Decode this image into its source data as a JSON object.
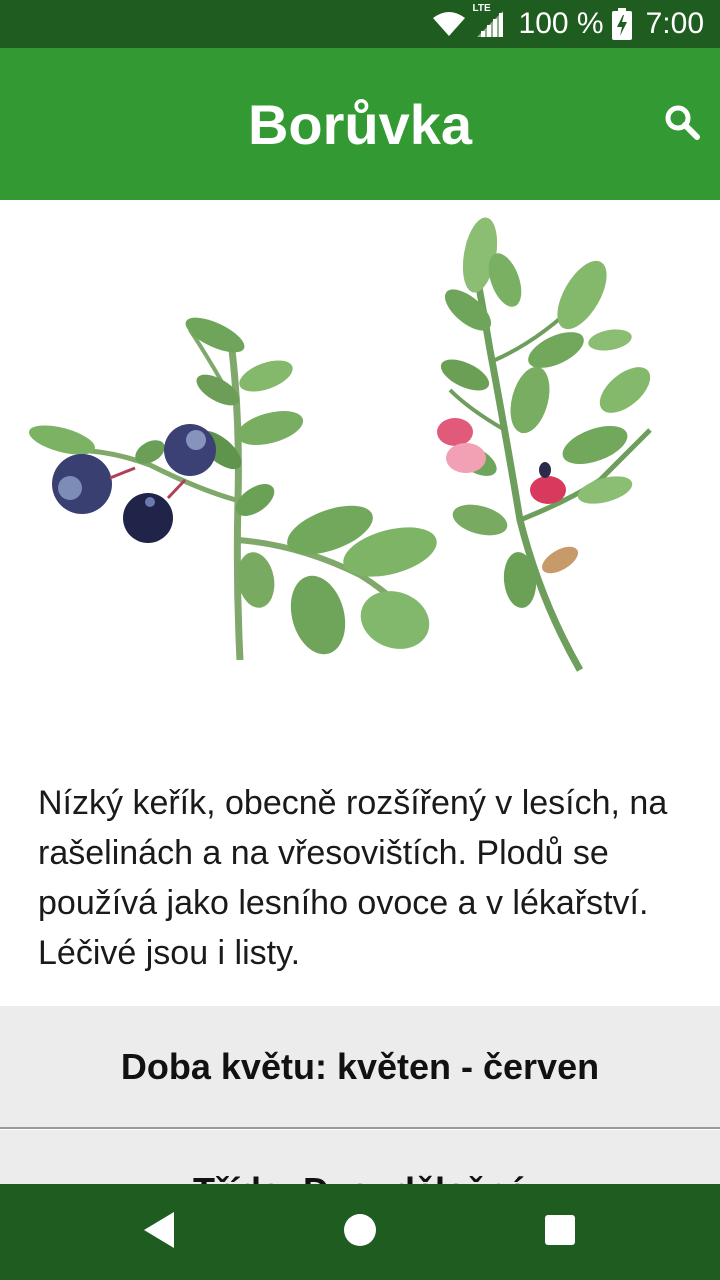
{
  "status_bar": {
    "network_type": "LTE",
    "battery_percent": "100 %",
    "time": "7:00",
    "icons": [
      "wifi-icon",
      "cell-signal-icon",
      "battery-charging-icon"
    ]
  },
  "app_bar": {
    "title": "Borůvka",
    "search_icon": "search-icon",
    "background_color": "#339933"
  },
  "content": {
    "illustration": "blueberry-plant-illustration",
    "description": "Nízký keřík, obecně rozšířený v lesích, na rašelinách a na vřesovištích. Plodů se používá jako lesního ovoce a v lékařství. Léčivé jsou i listy.",
    "info_rows": [
      {
        "label": "Doba květu: květen - červen"
      },
      {
        "label": "Třída: Dvouděložné"
      }
    ]
  },
  "nav_bar": {
    "buttons": [
      "back-icon",
      "home-icon",
      "recents-icon"
    ],
    "background_color": "#1f5c1f"
  }
}
